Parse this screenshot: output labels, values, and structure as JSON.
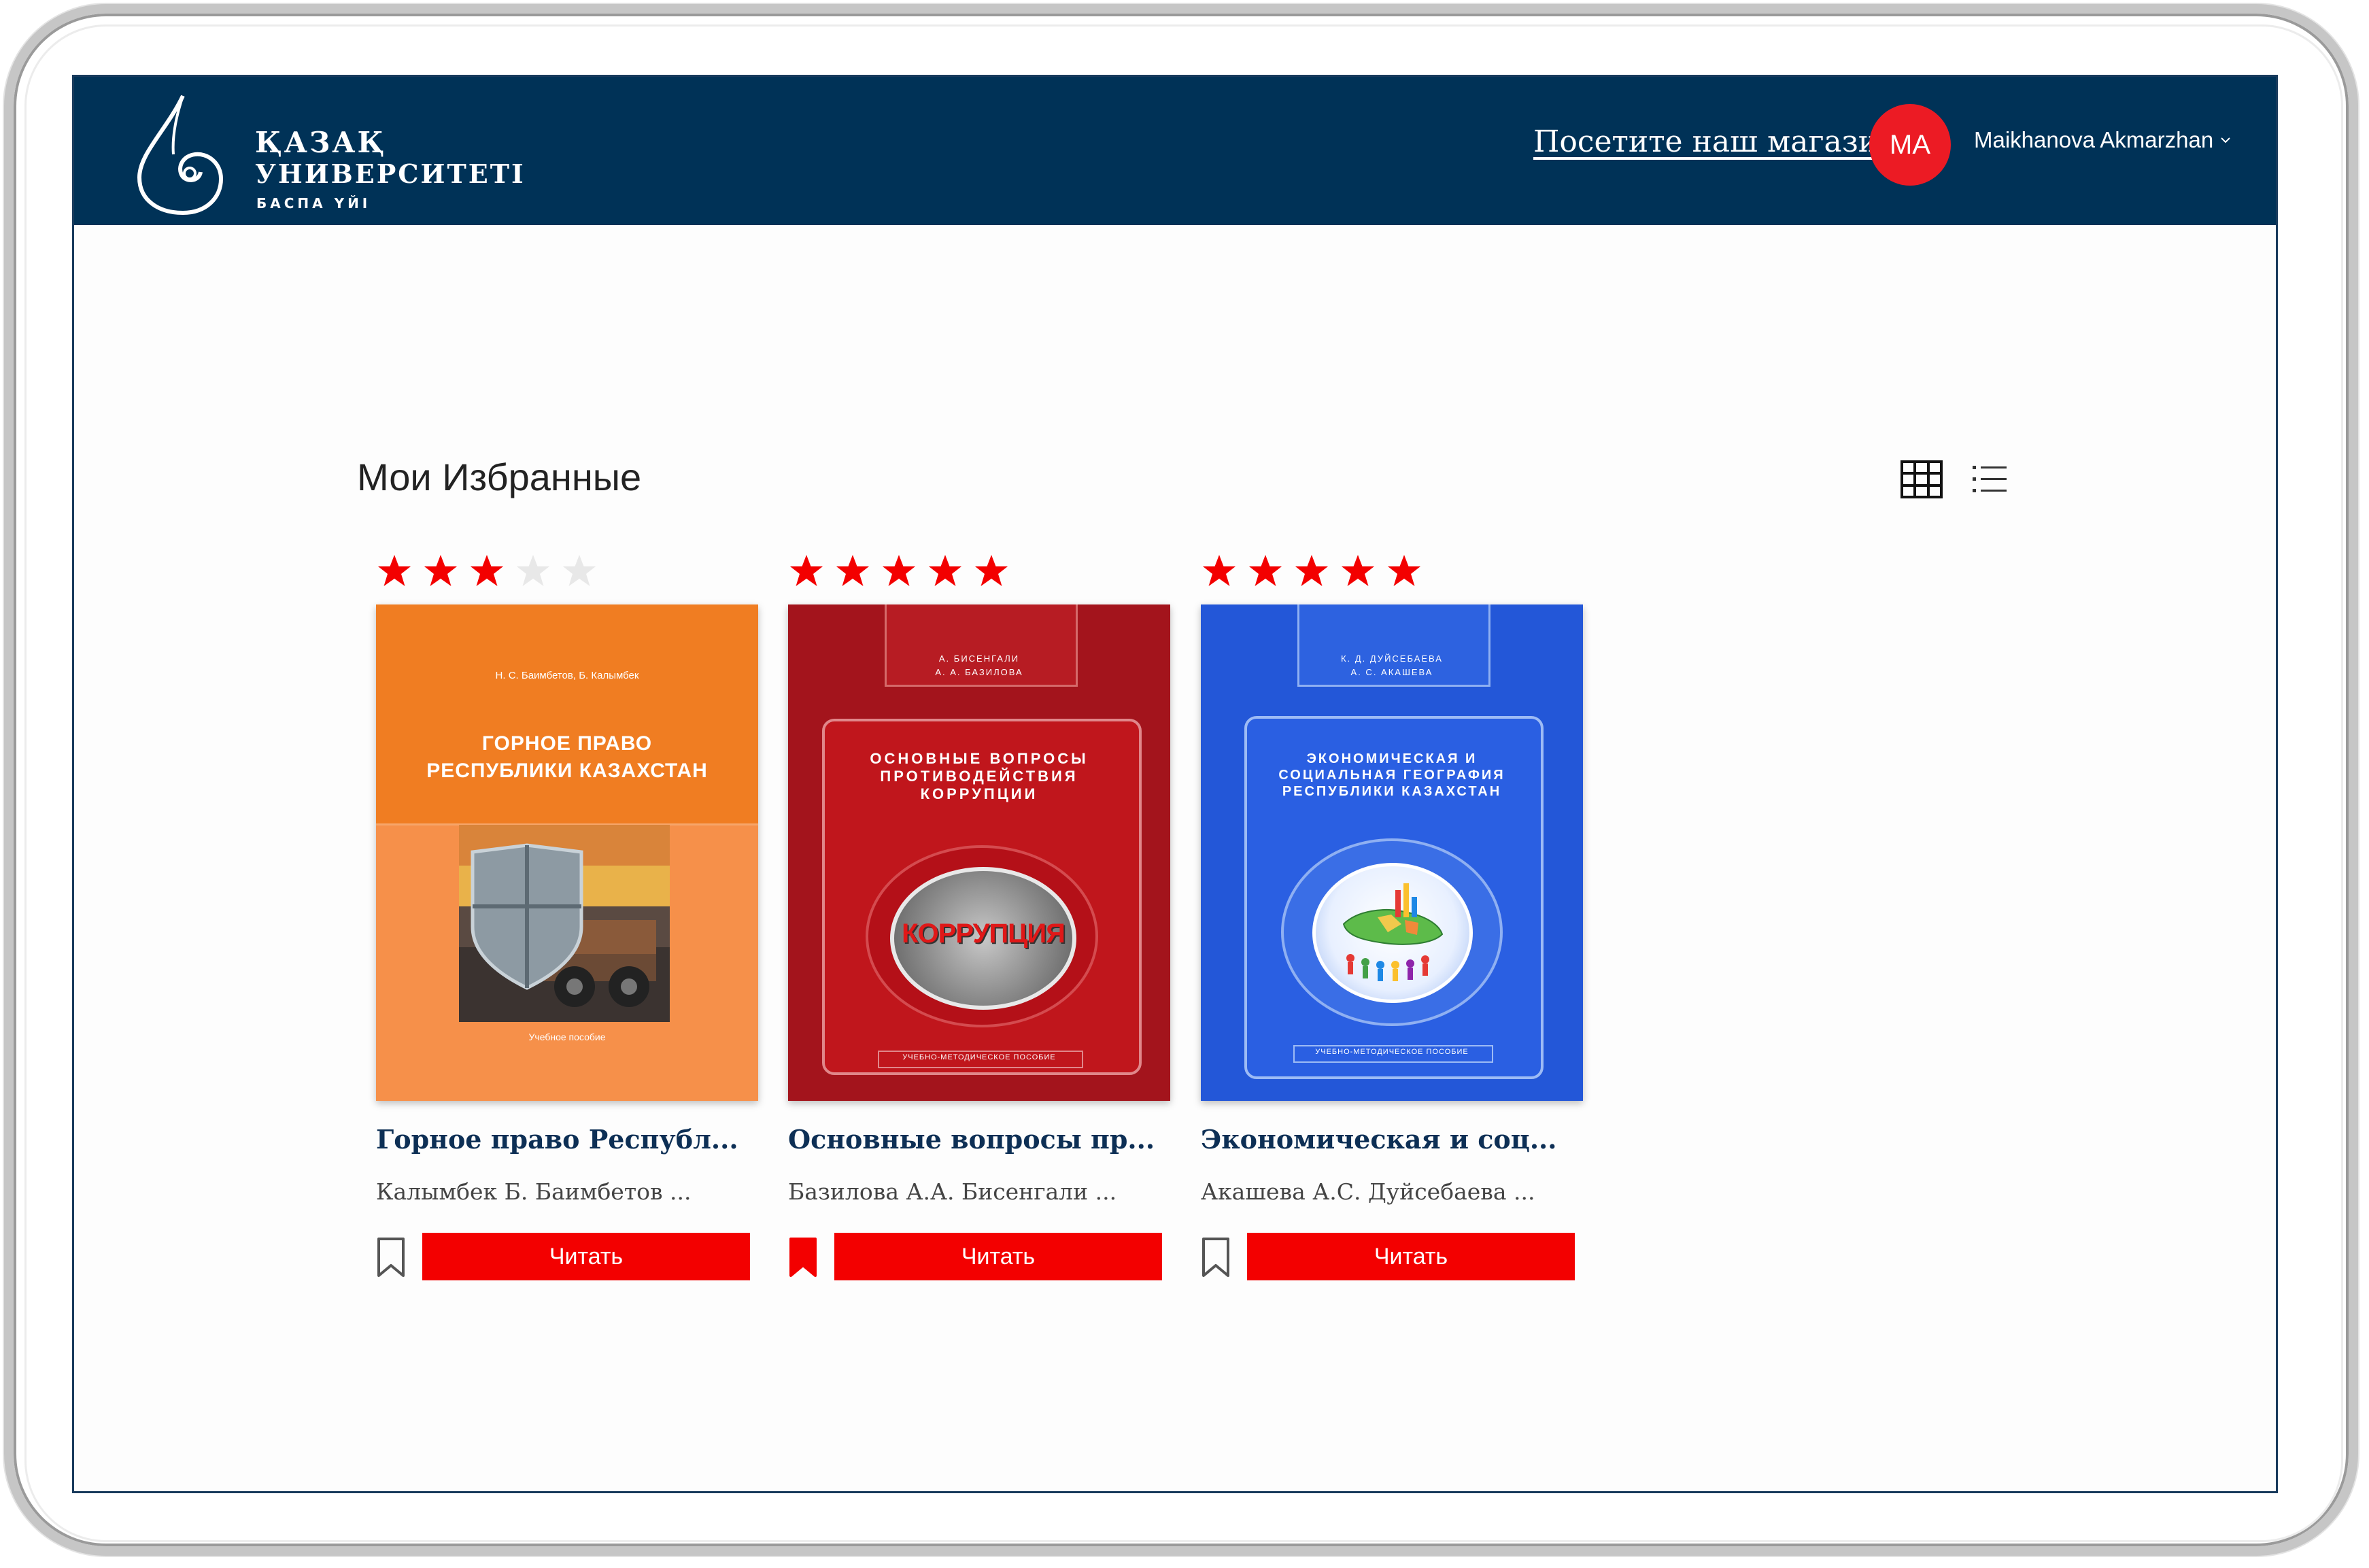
{
  "header": {
    "logo": {
      "line1": "ҚАЗАҚ",
      "line2": "УНИВЕРСИТЕТІ",
      "line3": "БАСПА ҮЙІ"
    },
    "shop_link": "Посетите наш магазин",
    "avatar_initials": "MA",
    "user_name": "Maikhanova Akmarzhan"
  },
  "main": {
    "title": "Мои Избранные",
    "view_modes": [
      "grid-icon",
      "list-icon"
    ],
    "books": [
      {
        "rating": 3,
        "title": "Горное право Республ...",
        "authors": "Калымбек Б.   Баимбетов ...",
        "bookmarked": false,
        "read_label": "Читать",
        "cover": {
          "color": "#f58225",
          "authors": "Н. С. Баимбетов, Б. Калымбек",
          "title_line1": "ГОРНОЕ ПРАВО",
          "title_line2": "РЕСПУБЛИКИ КАЗАХСТАН",
          "subtitle": "Учебное пособие"
        }
      },
      {
        "rating": 5,
        "title": "Основные вопросы пр...",
        "authors": "Базилова А.А.   Бисенгали ...",
        "bookmarked": true,
        "read_label": "Читать",
        "cover": {
          "color": "#a3141c",
          "authors_line1": "А. БИСЕНГАЛИ",
          "authors_line2": "А. А. БАЗИЛОВА",
          "title_line1": "ОСНОВНЫЕ ВОПРОСЫ",
          "title_line2": "ПРОТИВОДЕЙСТВИЯ",
          "title_line3": "КОРРУПЦИИ",
          "center_word": "КОРРУПЦИЯ",
          "subtitle": "УЧЕБНО-МЕТОДИЧЕСКОЕ ПОСОБИЕ"
        }
      },
      {
        "rating": 5,
        "title": "Экономическая и соц...",
        "authors": "Акашева А.С.   Дуйсебаева ...",
        "bookmarked": false,
        "read_label": "Читать",
        "cover": {
          "color": "#2357d8",
          "authors_line1": "К. Д. ДУЙСЕБАЕВА",
          "authors_line2": "А. С. АКАШЕВА",
          "title_line1": "ЭКОНОМИЧЕСКАЯ И",
          "title_line2": "СОЦИАЛЬНАЯ ГЕОГРАФИЯ",
          "title_line3": "РЕСПУБЛИКИ КАЗАХСТАН",
          "subtitle": "УЧЕБНО-МЕТОДИЧЕСКОЕ ПОСОБИЕ"
        }
      }
    ]
  },
  "colors": {
    "header_bg": "#003257",
    "accent_red": "#f30000",
    "star_red": "#f30000",
    "star_empty": "#e8e8e8",
    "title_blue": "#0d2f55"
  }
}
